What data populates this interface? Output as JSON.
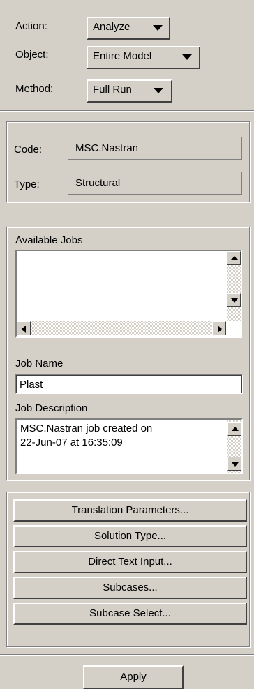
{
  "header": {
    "action": {
      "label": "Action:",
      "value": "Analyze"
    },
    "object": {
      "label": "Object:",
      "value": "Entire Model"
    },
    "method": {
      "label": "Method:",
      "value": "Full Run"
    }
  },
  "info": {
    "code": {
      "label": "Code:",
      "value": "MSC.Nastran"
    },
    "type": {
      "label": "Type:",
      "value": "Structural"
    }
  },
  "jobs": {
    "available_label": "Available Jobs",
    "available_items": [],
    "job_name_label": "Job Name",
    "job_name_value": "Plast",
    "job_description_label": "Job Description",
    "job_description_value": "MSC.Nastran job created on\n22-Jun-07 at 16:35:09"
  },
  "buttons": {
    "translation_parameters": "Translation Parameters...",
    "solution_type": "Solution Type...",
    "direct_text_input": "Direct Text Input...",
    "subcases": "Subcases...",
    "subcase_select": "Subcase Select..."
  },
  "apply_label": "Apply",
  "icons": {
    "option_menu": "triangle-down-icon",
    "scroll_up": "arrow-up-icon",
    "scroll_down": "arrow-down-icon",
    "scroll_left": "arrow-left-icon",
    "scroll_right": "arrow-right-icon"
  }
}
